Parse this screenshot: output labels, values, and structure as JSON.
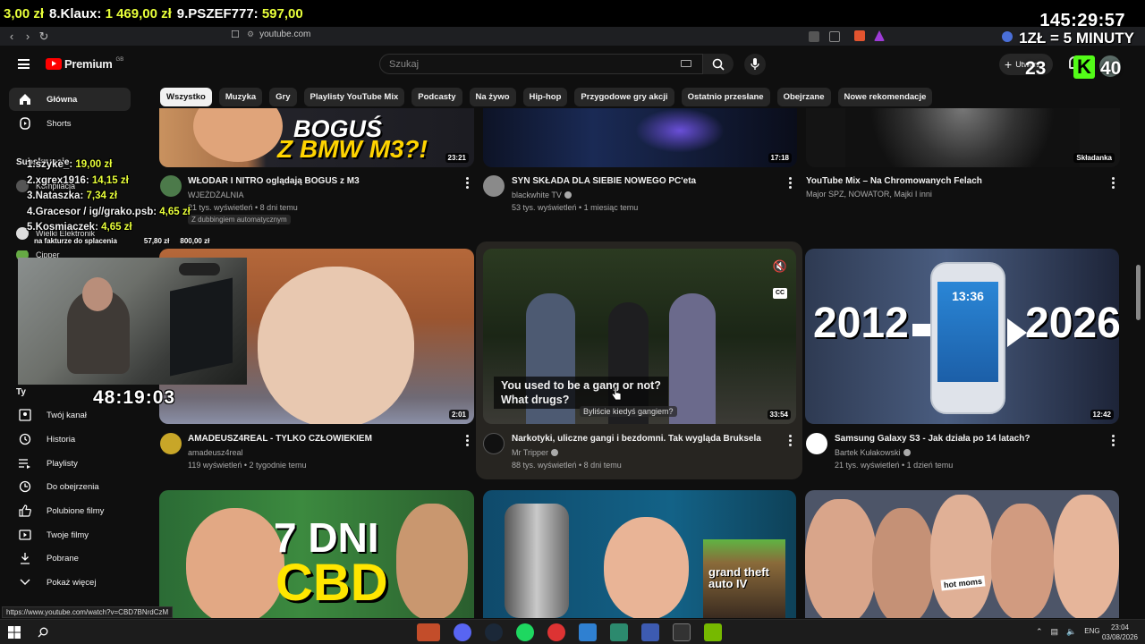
{
  "stream": {
    "donors": [
      {
        "num": "3,00 zł",
        "amt": ""
      },
      {
        "num": "8.Klaux:",
        "amt": "1 469,00 zł"
      },
      {
        "num": "9.PSZEF777:",
        "amt": "597,00"
      }
    ],
    "timer_main": "145:29:57",
    "timer_rate": "1ZŁ = 5 MINUTY",
    "count_a": "23",
    "count_b": "40",
    "top_donors": [
      {
        "name": "1.szyke_:",
        "amt": "19,00 zł"
      },
      {
        "name": "2.xgrex1916:",
        "amt": "14,15 zł"
      },
      {
        "name": "3.Nataszka:",
        "amt": "7,34 zł"
      },
      {
        "name": "4.Gracesor / ig//grako.psb:",
        "amt": "4,65 zł"
      },
      {
        "name": "5.Kosmiaczek:",
        "amt": "4,65 zł"
      }
    ],
    "invoice_label": "na fakturze do splacenia",
    "invoice_a": "57,80 zł",
    "invoice_b": "800,00 zł",
    "session_timer": "48:19:03"
  },
  "browser": {
    "url": "youtube.com",
    "status_url": "https://www.youtube.com/watch?v=CBD7BNrdCzM"
  },
  "masthead": {
    "logo": "Premium",
    "logo_sup": "GB",
    "search_placeholder": "Szukaj",
    "create_label": "Utwórz"
  },
  "chips": [
    "Wszystko",
    "Muzyka",
    "Gry",
    "Playlisty YouTube Mix",
    "Podcasty",
    "Na żywo",
    "Hip-hop",
    "Przygodowe gry akcji",
    "Ostatnio przesłane",
    "Obejrzane",
    "Nowe rekomendacje"
  ],
  "sidebar": {
    "home": "Główna",
    "shorts": "Shorts",
    "subs_header": "Subskrypcje",
    "subs": [
      "Kompilacja",
      "Wielki Elektronik",
      "Cipper"
    ],
    "you_header": "Ty",
    "you_items": [
      "Twój kanał",
      "Historia",
      "Playlisty",
      "Do obejrzenia",
      "Polubione filmy",
      "Twoje filmy",
      "Pobrane",
      "Pokaż więcej"
    ]
  },
  "videos": [
    {
      "title": "WŁODAR I NITRO oglądają BOGUS z M3",
      "channel": "WJEŻDŻALNIA",
      "meta": "21 tys. wyświetleń • 8 dni temu",
      "dub": "Z dubbingiem automatycznym",
      "duration": "23:21",
      "thumb_text_1": "BOGUŚ",
      "thumb_text_2": "Z BMW M3?!"
    },
    {
      "title": "SYN SKŁADA DLA SIEBIE NOWEGO PC'eta",
      "channel": "blackwhite TV",
      "meta": "53 tys. wyświetleń • 1 miesiąc temu",
      "duration": "17:18"
    },
    {
      "title": "YouTube Mix – Na Chromowanych Felach",
      "channel": "Major SPZ, NOWATOR, Majki I inni",
      "meta": "",
      "duration": "Składanka"
    },
    {
      "title": "AMADEUSZ4REAL - TYLKO CZŁOWIEKIEM",
      "channel": "amadeusz4real",
      "meta": "119 wyświetleń • 2 tygodnie temu",
      "duration": "2:01"
    },
    {
      "title": "Narkotyki, uliczne gangi i bezdomni. Tak wygląda Bruksela",
      "channel": "Mr Tripper",
      "meta": "88 tys. wyświetleń • 8 dni temu",
      "duration": "33:54",
      "caption_1": "You used to be a gang or not?",
      "caption_2": "What drugs?",
      "caption_pl": "Byliście kiedyś gangiem?"
    },
    {
      "title": "Samsung Galaxy S3 - Jak działa po 14 latach?",
      "channel": "Bartek Kułakowski",
      "meta": "21 tys. wyświetleń • 1 dzień temu",
      "duration": "12:42",
      "thumb_left": "2012",
      "thumb_right": "2026",
      "phone_time": "13:36"
    },
    {
      "title": "",
      "thumb_text_1": "7 DNI",
      "thumb_text_2": "CBD"
    },
    {
      "title": "",
      "thumb_text_1": "grand theft auto IV"
    },
    {
      "title": "",
      "thumb_text_1": "hot moms"
    }
  ],
  "taskbar": {
    "lang": "ENG",
    "time": "23:04",
    "date": "03/08/2026"
  }
}
